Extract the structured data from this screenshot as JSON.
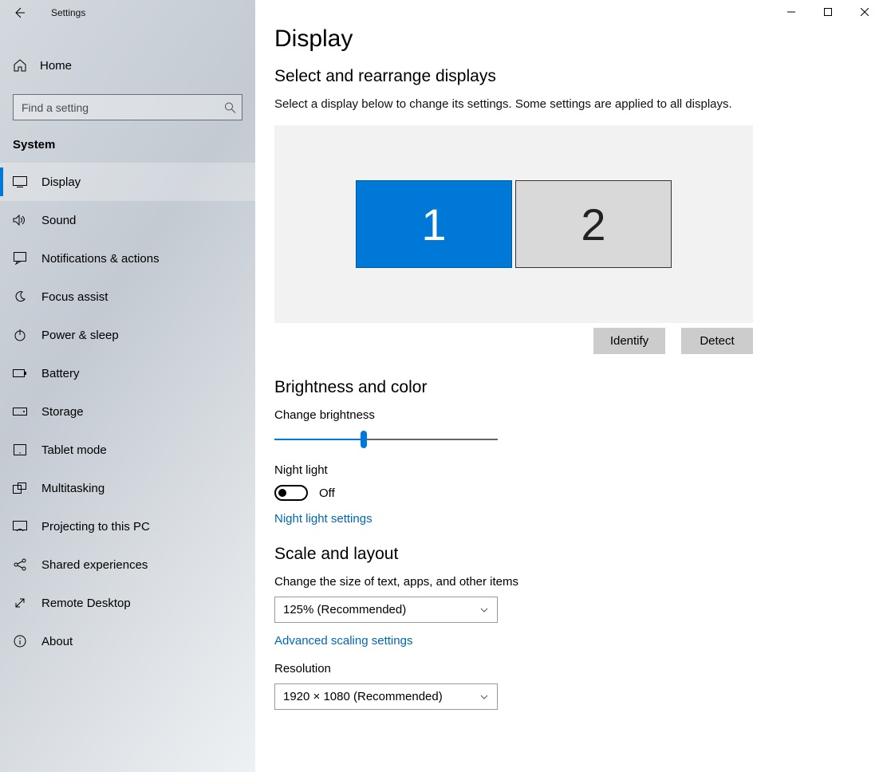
{
  "app": {
    "title": "Settings"
  },
  "sidebar": {
    "home": "Home",
    "search_placeholder": "Find a setting",
    "category": "System",
    "items": [
      {
        "label": "Display",
        "icon": "display-icon",
        "active": true
      },
      {
        "label": "Sound",
        "icon": "sound-icon",
        "active": false
      },
      {
        "label": "Notifications & actions",
        "icon": "notifications-icon",
        "active": false
      },
      {
        "label": "Focus assist",
        "icon": "focus-assist-icon",
        "active": false
      },
      {
        "label": "Power & sleep",
        "icon": "power-icon",
        "active": false
      },
      {
        "label": "Battery",
        "icon": "battery-icon",
        "active": false
      },
      {
        "label": "Storage",
        "icon": "storage-icon",
        "active": false
      },
      {
        "label": "Tablet mode",
        "icon": "tablet-icon",
        "active": false
      },
      {
        "label": "Multitasking",
        "icon": "multitasking-icon",
        "active": false
      },
      {
        "label": "Projecting to this PC",
        "icon": "projecting-icon",
        "active": false
      },
      {
        "label": "Shared experiences",
        "icon": "shared-icon",
        "active": false
      },
      {
        "label": "Remote Desktop",
        "icon": "remote-icon",
        "active": false
      },
      {
        "label": "About",
        "icon": "about-icon",
        "active": false
      }
    ]
  },
  "main": {
    "page_title": "Display",
    "section_arrange": {
      "title": "Select and rearrange displays",
      "description": "Select a display below to change its settings. Some settings are applied to all displays.",
      "monitors": [
        {
          "id": "1",
          "selected": true
        },
        {
          "id": "2",
          "selected": false
        }
      ],
      "identify_btn": "Identify",
      "detect_btn": "Detect"
    },
    "section_brightness": {
      "title": "Brightness and color",
      "brightness_label": "Change brightness",
      "brightness_value_percent": 40,
      "night_light_label": "Night light",
      "night_light_state": "Off",
      "night_light_link": "Night light settings"
    },
    "section_scale": {
      "title": "Scale and layout",
      "scale_label": "Change the size of text, apps, and other items",
      "scale_value": "125% (Recommended)",
      "advanced_link": "Advanced scaling settings",
      "resolution_label": "Resolution",
      "resolution_value": "1920 × 1080 (Recommended)"
    }
  },
  "icons": {
    "home": "⌂",
    "display": "🖵",
    "sound": "🕪",
    "moon": "☽"
  }
}
